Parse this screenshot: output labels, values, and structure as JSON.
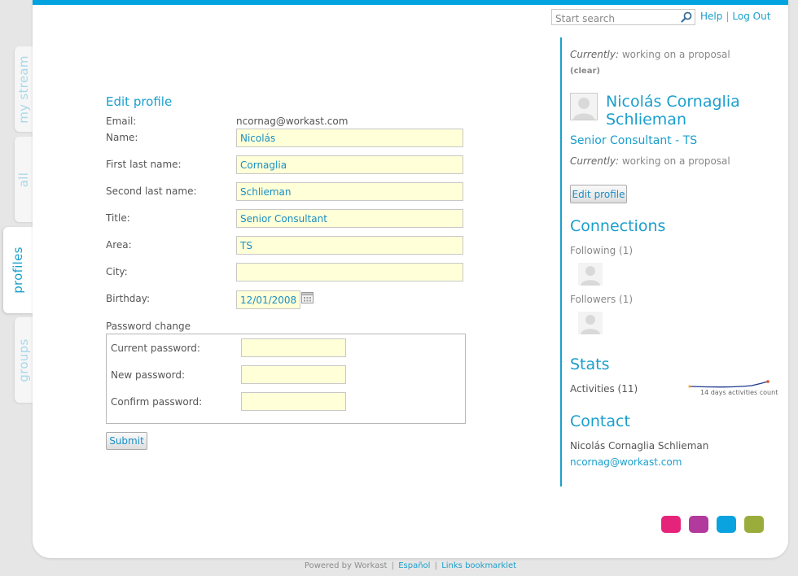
{
  "tabs": [
    "my stream",
    "all",
    "profiles",
    "groups"
  ],
  "header": {
    "search_placeholder": "Start search",
    "help_label": "Help",
    "separator": "|",
    "logout_label": "Log Out"
  },
  "form": {
    "title": "Edit profile",
    "email_label": "Email:",
    "email_value": "ncornag@workast.com",
    "name_label": "Name:",
    "name_value": "Nicolás",
    "first_last_label": "First last name:",
    "first_last_value": "Cornaglia",
    "second_last_label": "Second last name:",
    "second_last_value": "Schlieman",
    "title_label": "Title:",
    "title_value": "Senior Consultant",
    "area_label": "Area:",
    "area_value": "TS",
    "city_label": "City:",
    "city_value": "",
    "birthday_label": "Birthday:",
    "birthday_value": "12/01/2008",
    "password_change_label": "Password change",
    "current_password_label": "Current password:",
    "new_password_label": "New password:",
    "confirm_password_label": "Confirm password:",
    "submit_label": "Submit"
  },
  "sidebar": {
    "currently_label": "Currently:",
    "status_text": "working on a proposal",
    "clear_label": "(clear)",
    "profile_name": "Nicolás Cornaglia Schlieman",
    "job_title": "Senior Consultant - TS",
    "edit_profile_label": "Edit profile",
    "connections_heading": "Connections",
    "following_label": "Following (1)",
    "followers_label": "Followers (1)",
    "stats_heading": "Stats",
    "activities_label": "Activities (11)",
    "sparkline_label": "14 days activities count",
    "contact_heading": "Contact",
    "contact_name": "Nicolás Cornaglia Schlieman",
    "contact_email": "ncornag@workast.com"
  },
  "theme_colors": [
    "#e6237a",
    "#b23a9c",
    "#0aa3e0",
    "#9aac3c"
  ],
  "footer": {
    "powered_by": "Powered by Workast",
    "language": "Español",
    "bookmarklet": "Links bookmarklet",
    "separator": "|"
  }
}
